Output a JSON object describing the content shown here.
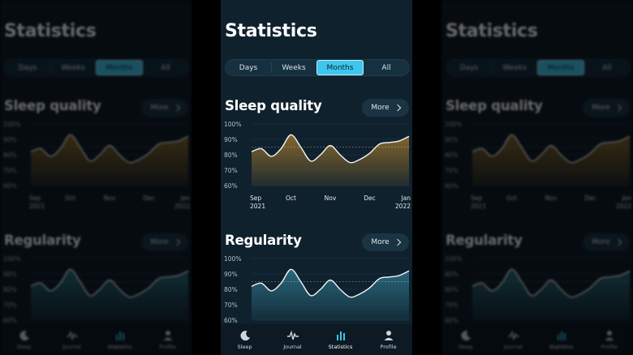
{
  "screen": {
    "title": "Statistics",
    "tabs": [
      {
        "label": "Days",
        "active": false
      },
      {
        "label": "Weeks",
        "active": false
      },
      {
        "label": "Months",
        "active": true
      },
      {
        "label": "All",
        "active": false
      }
    ],
    "sections": [
      {
        "title": "Sleep quality",
        "more_label": "More",
        "color": "#e29a3e",
        "fill_top": "#8a6a2c"
      },
      {
        "title": "Regularity",
        "more_label": "More",
        "color": "#4fc3e0",
        "fill_top": "#2a6c80"
      }
    ],
    "tabbar": [
      {
        "label": "Sleep",
        "icon": "moon-icon",
        "active": false
      },
      {
        "label": "Journal",
        "icon": "pulse-icon",
        "active": false
      },
      {
        "label": "Statistics",
        "icon": "bar-chart-icon",
        "active": true
      },
      {
        "label": "Profile",
        "icon": "person-icon",
        "active": false
      }
    ],
    "accent": "#3ec6ec"
  },
  "chart_data": [
    {
      "type": "area",
      "y_ticks": [
        "100%",
        "90%",
        "80%",
        "70%",
        "60%"
      ],
      "ylim": [
        60,
        100
      ],
      "x_ticks": [
        {
          "line1": "Sep",
          "line2": "2021"
        },
        {
          "line1": "Oct",
          "line2": ""
        },
        {
          "line1": "Nov",
          "line2": ""
        },
        {
          "line1": "Dec",
          "line2": ""
        },
        {
          "line1": "Jan",
          "line2": "2022"
        }
      ],
      "reference_value": 85,
      "x": [
        0,
        0.25,
        0.5,
        0.75,
        1,
        1.25,
        1.5,
        1.75,
        2,
        2.25,
        2.5,
        2.75,
        3,
        3.25,
        3.5,
        3.75,
        4
      ],
      "y": [
        82,
        84,
        79,
        84,
        93,
        85,
        76,
        80,
        86,
        80,
        75,
        77,
        81,
        87,
        88,
        89,
        92
      ]
    },
    {
      "type": "area",
      "y_ticks": [
        "100%",
        "90%",
        "80%",
        "70%",
        "60%"
      ],
      "ylim": [
        60,
        100
      ],
      "x_ticks": [],
      "reference_value": 85,
      "x": [
        0,
        0.25,
        0.5,
        0.75,
        1,
        1.25,
        1.5,
        1.75,
        2,
        2.25,
        2.5,
        2.75,
        3,
        3.25,
        3.5,
        3.75,
        4
      ],
      "y": [
        82,
        84,
        79,
        84,
        93,
        85,
        76,
        80,
        86,
        80,
        75,
        77,
        81,
        87,
        88,
        89,
        92
      ]
    }
  ]
}
